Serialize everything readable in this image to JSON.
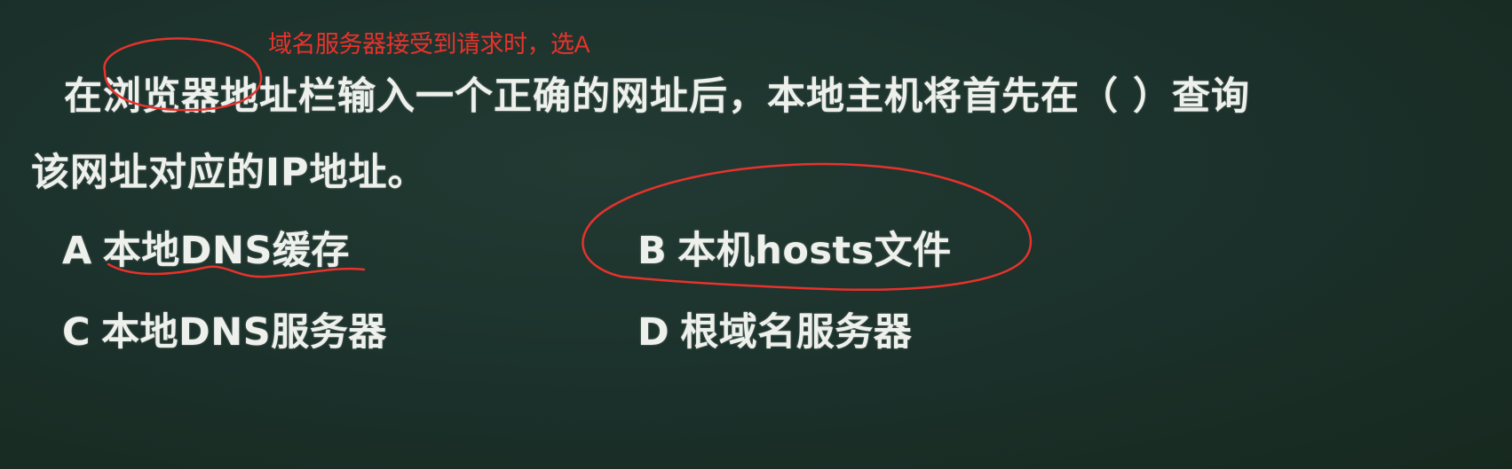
{
  "annotation": {
    "text": "域名服务器接受到请求时，选A",
    "color": "#e8322c"
  },
  "question": {
    "line1": "在浏览器地址栏输入一个正确的网址后，本地主机将首先在（ ）查询",
    "line2": "该网址对应的IP地址。"
  },
  "options": {
    "a": {
      "letter": "A",
      "text": "本地DNS缓存"
    },
    "b": {
      "letter": "B",
      "text": "本机hosts文件"
    },
    "c": {
      "letter": "C",
      "text": "本地DNS服务器"
    },
    "d": {
      "letter": "D",
      "text": "根域名服务器"
    }
  },
  "colors": {
    "board": "#1a2e28",
    "chalk_text": "#eef0ec",
    "ink": "#e8322c"
  }
}
